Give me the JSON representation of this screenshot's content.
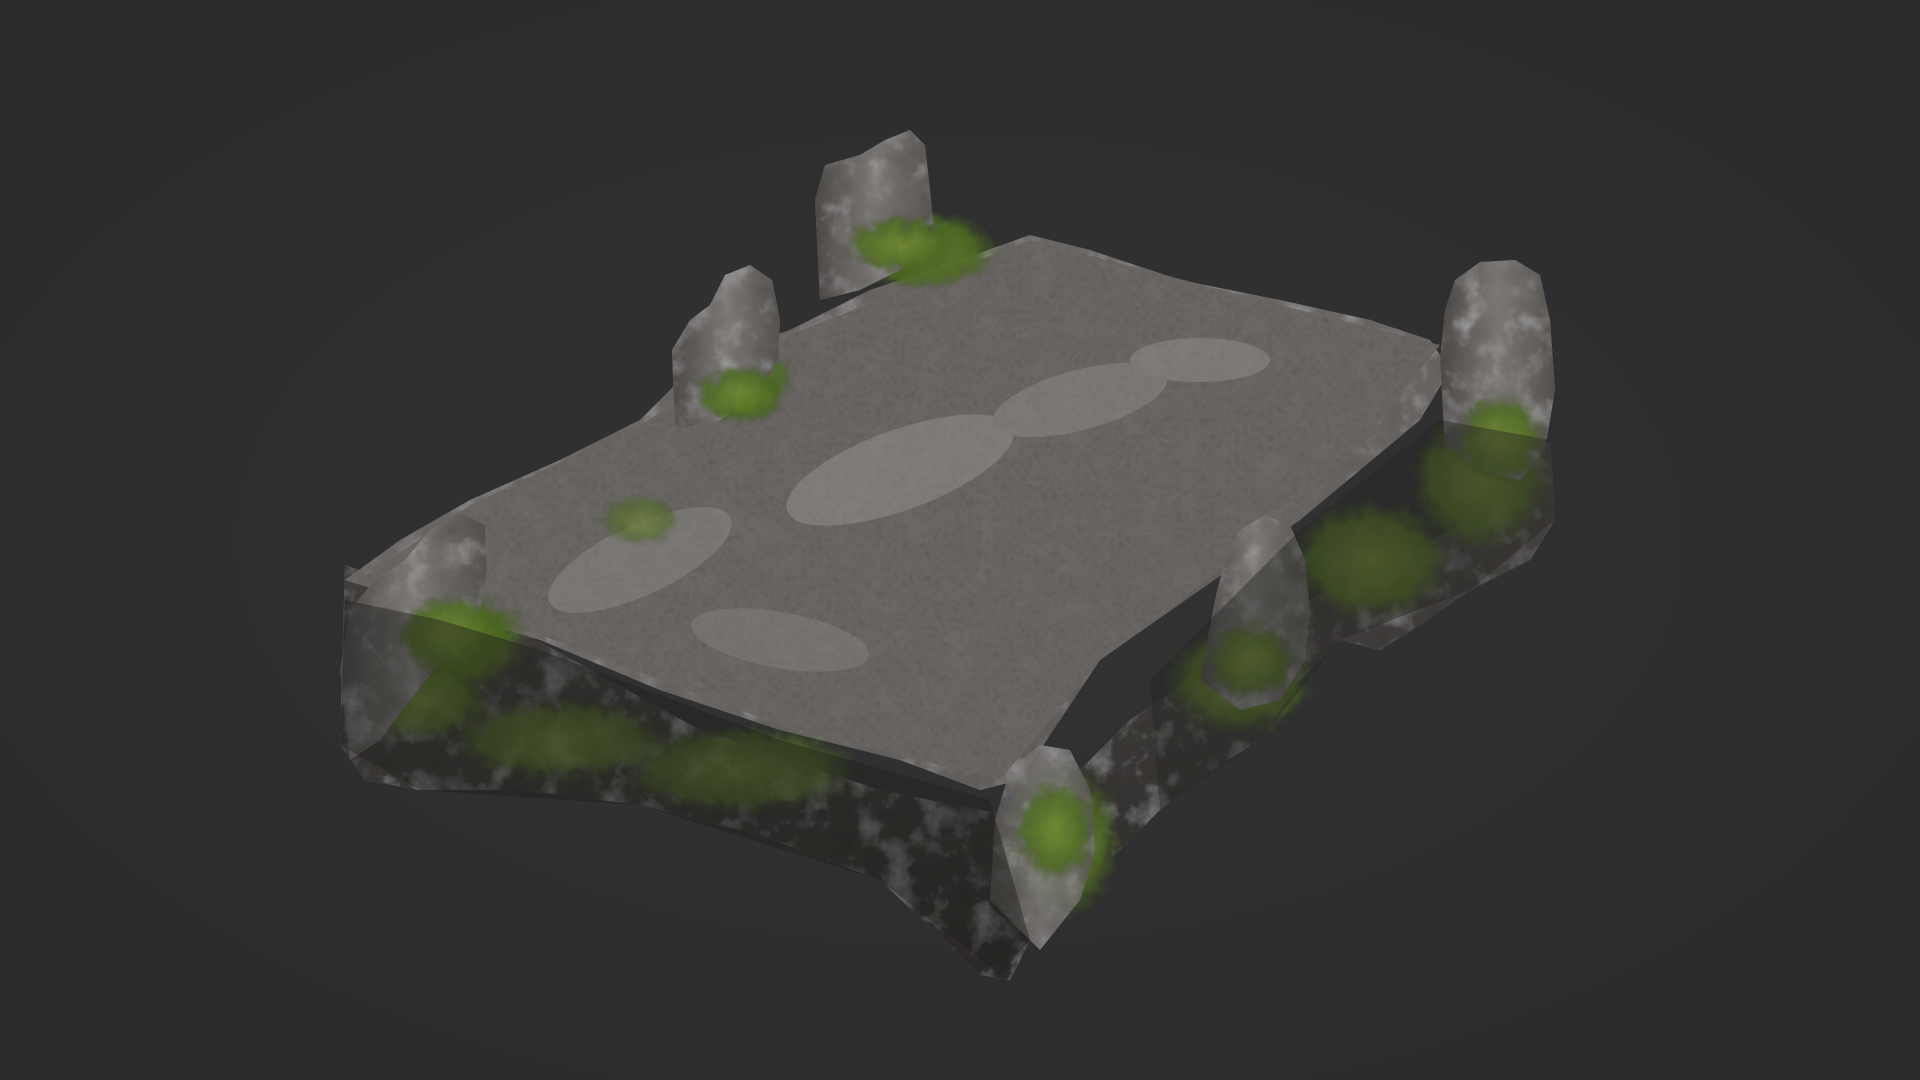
{
  "scene": {
    "background_color": "#2f2f30",
    "object": "mossy-rock-platform",
    "colors": {
      "rock_light": "#8a8785",
      "rock_mid": "#6b6866",
      "rock_dark": "#3e3b3a",
      "moss_light": "#6f8a2e",
      "moss_dark": "#3d5420"
    }
  }
}
